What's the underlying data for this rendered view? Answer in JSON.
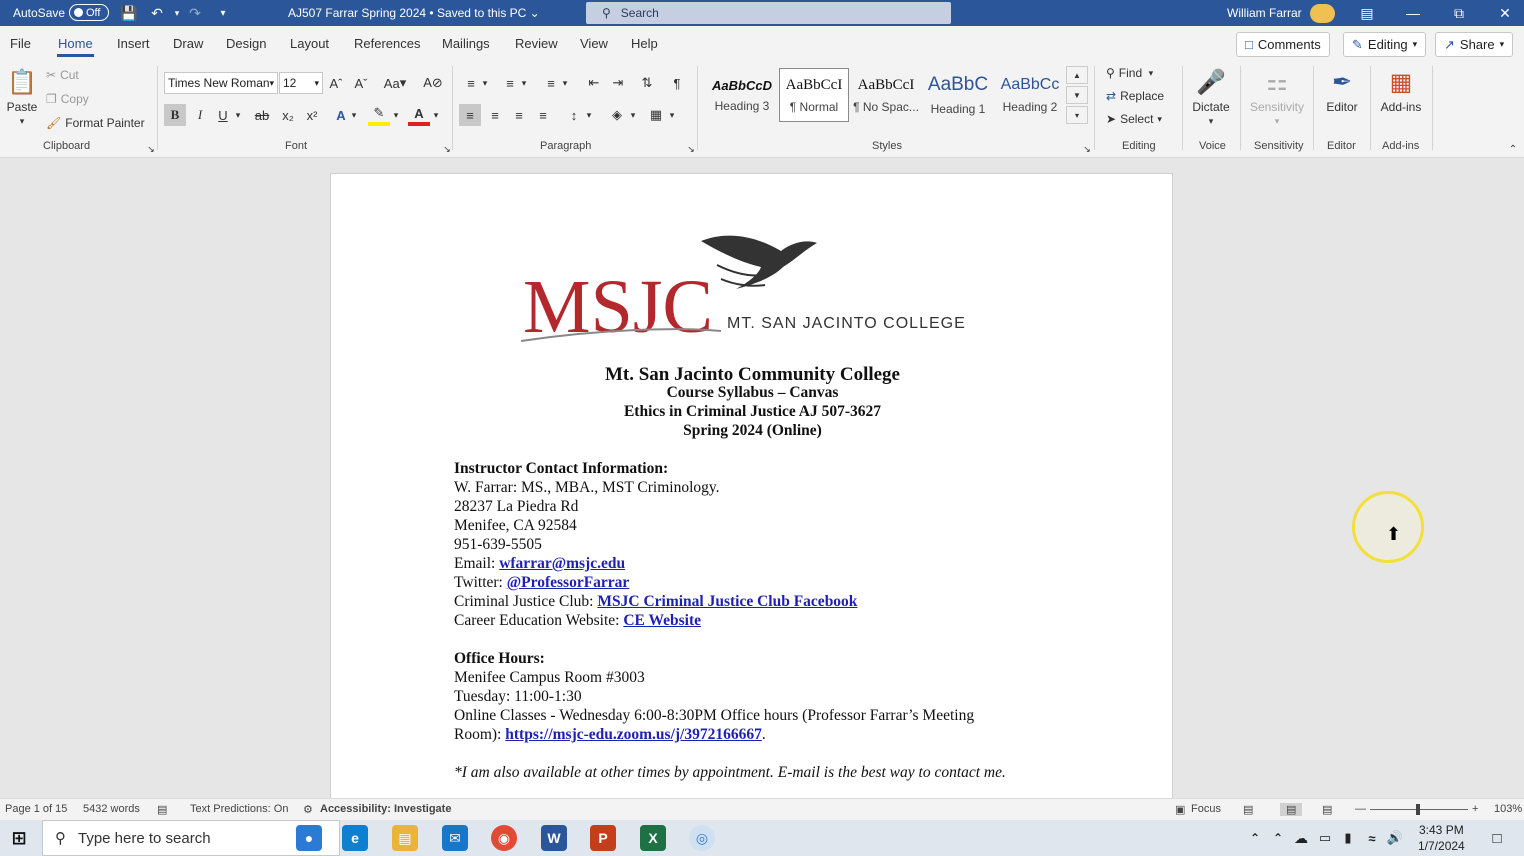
{
  "titlebar": {
    "autosave_label": "AutoSave",
    "autosave_state": "Off",
    "document_title": "AJ507 Farrar Spring 2024 • Saved to this PC",
    "search_placeholder": "Search",
    "user_name": "William Farrar",
    "accent_color": "#2b579a"
  },
  "menu": {
    "tabs": [
      "File",
      "Home",
      "Insert",
      "Draw",
      "Design",
      "Layout",
      "References",
      "Mailings",
      "Review",
      "View",
      "Help"
    ],
    "active_tab": "Home",
    "comments_label": "Comments",
    "editing_label": "Editing",
    "share_label": "Share"
  },
  "ribbon": {
    "clipboard": {
      "paste": "Paste",
      "cut": "Cut",
      "copy": "Copy",
      "format_painter": "Format Painter",
      "label": "Clipboard"
    },
    "font": {
      "family": "Times New Roman",
      "size": "12",
      "label": "Font",
      "change_case": "Aa"
    },
    "paragraph": {
      "label": "Paragraph"
    },
    "styles": {
      "label": "Styles",
      "items": [
        {
          "sample": "AaBbCcD",
          "name": "Heading 3"
        },
        {
          "sample": "AaBbCcI",
          "name": "¶ Normal"
        },
        {
          "sample": "AaBbCcI",
          "name": "¶ No Spac..."
        },
        {
          "sample": "AaBbC",
          "name": "Heading 1"
        },
        {
          "sample": "AaBbCc",
          "name": "Heading 2"
        }
      ]
    },
    "editing": {
      "find": "Find",
      "replace": "Replace",
      "select": "Select",
      "label": "Editing"
    },
    "voice": {
      "dictate": "Dictate",
      "label": "Voice"
    },
    "sensitivity": {
      "button": "Sensitivity",
      "label": "Sensitivity"
    },
    "editor": {
      "button": "Editor",
      "label": "Editor"
    },
    "addins": {
      "button": "Add-ins",
      "label": "Add-ins"
    }
  },
  "document": {
    "logo_text": "MSJC",
    "logo_sub": "MT. SAN JACINTO COLLEGE",
    "college": "Mt. San Jacinto Community College",
    "syllabus": "Course Syllabus – Canvas",
    "course": "Ethics in Criminal Justice AJ 507-3627",
    "term": "Spring 2024 (Online)",
    "contact_heading": "Instructor Contact Information:",
    "instructor": "W. Farrar: MS., MBA., MST Criminology.",
    "address1": "28237 La Piedra Rd",
    "address2": "Menifee, CA 92584",
    "phone": "951-639-5505",
    "email_label": "Email: ",
    "email": "wfarrar@msjc.edu",
    "twitter_label": "Twitter: ",
    "twitter": "@ProfessorFarrar",
    "club_label": "Criminal Justice Club: ",
    "club_link": "MSJC Criminal Justice Club Facebook",
    "ce_label": "Career Education Website: ",
    "ce_link": "CE Website",
    "office_heading": "Office Hours:",
    "room": "Menifee Campus Room #3003",
    "tuesday": "Tuesday: 11:00-1:30",
    "online_line1": "Online Classes - Wednesday 6:00-8:30PM Office hours (Professor Farrar’s Meeting",
    "online_line2_label": "Room): ",
    "zoom_link": "https://msjc-edu.zoom.us/j/3972166667",
    "period": ".",
    "note": "*I am also available at other times by appointment. E-mail is the best way to contact me."
  },
  "statusbar": {
    "page": "Page 1 of 15",
    "words": "5432 words",
    "predictions": "Text Predictions: On",
    "accessibility": "Accessibility: Investigate",
    "focus": "Focus",
    "zoom": "103%"
  },
  "taskbar": {
    "search_placeholder": "Type here to search",
    "time": "3:43 PM",
    "date": "1/7/2024"
  }
}
